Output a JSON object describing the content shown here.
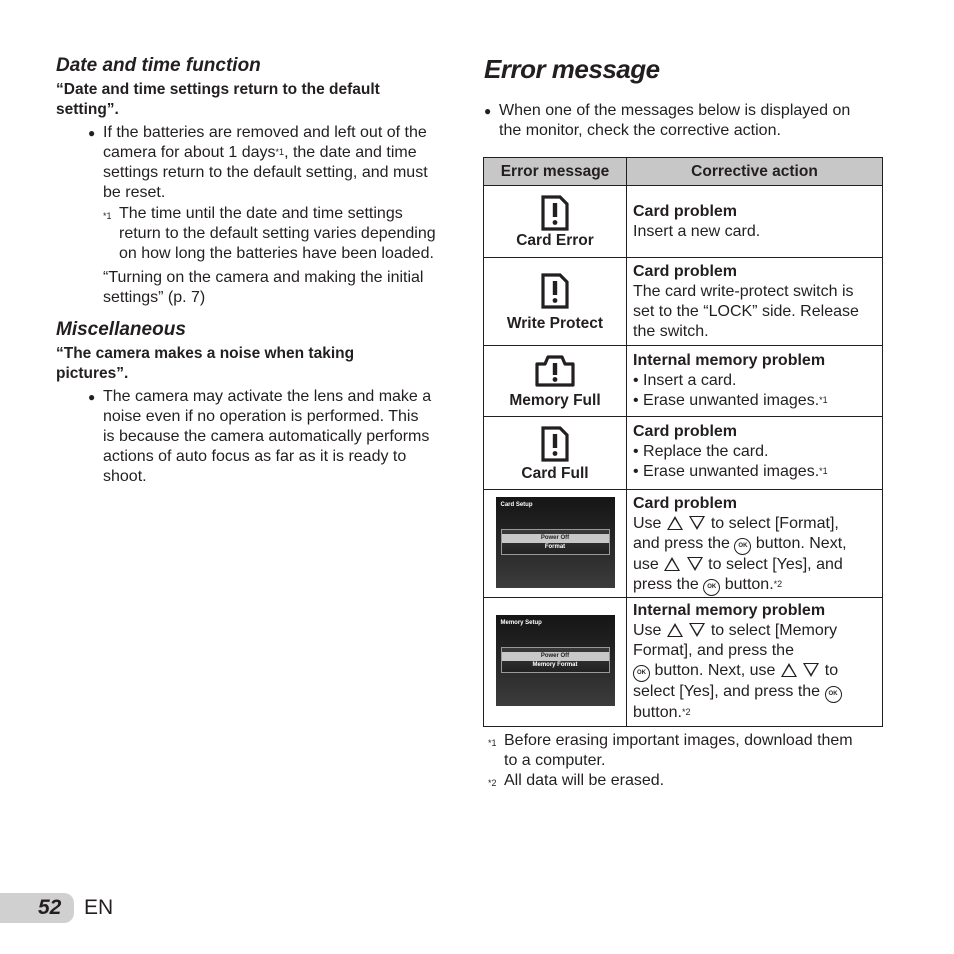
{
  "left": {
    "section1": {
      "heading": "Date and time function",
      "question": [
        "“Date and time settings return to the default",
        "setting”."
      ],
      "bullet_lines": [
        "If the batteries are removed and left out of the",
        "camera for about 1 days",
        ", the date and time",
        "settings return to the default setting, and must",
        "be reset."
      ],
      "bullet_sup": "*1",
      "note_mark": "*1",
      "note_lines": [
        "The time until the date and time settings",
        "return to the default setting varies depending",
        "on how long the batteries have been loaded."
      ],
      "ref_lines": [
        "“Turning on the camera and making the initial",
        "settings” (p. 7)"
      ]
    },
    "section2": {
      "heading": "Miscellaneous",
      "question": [
        "“The camera makes a noise when taking",
        "pictures”."
      ],
      "bullet_lines": [
        "The camera may activate the lens and make a",
        "noise even if no operation is performed. This",
        "is because the camera automatically performs",
        "actions of auto focus as far as it is ready to",
        "shoot."
      ]
    }
  },
  "right": {
    "title": "Error message",
    "intro_lines": [
      "When one of the messages below is displayed on",
      "the monitor, check the corrective action."
    ],
    "table": {
      "headers": [
        "Error message",
        "Corrective action"
      ],
      "rows": [
        {
          "icon": "card-error-icon",
          "message": "Card Error",
          "cause": "Card problem",
          "action": [
            "Insert a new card."
          ]
        },
        {
          "icon": "card-write-protect-icon",
          "message": "Write Protect",
          "cause": "Card problem",
          "action": [
            "The card write-protect switch is",
            "set to the “LOCK” side. Release",
            "the switch."
          ]
        },
        {
          "icon": "memory-full-icon",
          "message": "Memory Full",
          "cause": "Internal memory problem",
          "action": [
            "• Insert a card.",
            "• Erase unwanted images."
          ],
          "sup": "*1"
        },
        {
          "icon": "card-full-icon",
          "message": "Card Full",
          "cause": "Card problem",
          "action": [
            "• Replace the card.",
            "• Erase unwanted images."
          ],
          "sup": "*1"
        },
        {
          "screen": {
            "title": "Card Setup",
            "options": [
              "Power Off",
              "Format"
            ]
          },
          "cause": "Card problem",
          "action": {
            "l1a": "Use",
            "l1b": "to select [Format],",
            "l2a": "and press the",
            "l2b": "button. Next,",
            "l3a": "use",
            "l3b": "to select [Yes], and",
            "l4a": "press the",
            "l4b": "button."
          },
          "sup": "*2"
        },
        {
          "screen": {
            "title": "Memory Setup",
            "options": [
              "Power Off",
              "Memory Format"
            ]
          },
          "cause": "Internal memory problem",
          "action": {
            "l1a": "Use",
            "l1b": "to select [Memory",
            "l2": "Format], and press the",
            "l3b": "button. Next, use",
            "l3c": "to",
            "l4": "select [Yes], and press the",
            "l5": "button."
          },
          "sup": "*2"
        }
      ],
      "ok_label": "OK"
    },
    "footnotes": [
      {
        "mark": "*1",
        "lines": [
          "Before erasing important images, download them",
          "to a computer."
        ]
      },
      {
        "mark": "*2",
        "lines": [
          "All data will be erased."
        ]
      }
    ]
  },
  "footer": {
    "page_number": "52",
    "language": "EN"
  }
}
